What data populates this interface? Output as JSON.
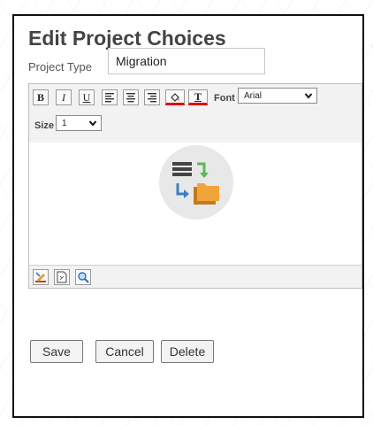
{
  "dialog": {
    "title": "Edit Project Choices",
    "project_type_label": "Project Type",
    "project_type_value": "Migration"
  },
  "toolbar": {
    "bold": "B",
    "italic": "I",
    "underline": "U",
    "text_color": "T",
    "font_label": "Font",
    "font_value": "Arial",
    "size_label": "Size",
    "size_value": "1"
  },
  "icons": {
    "toolbar": [
      "bold-icon",
      "italic-icon",
      "underline-icon",
      "align-left-icon",
      "align-center-icon",
      "align-right-icon",
      "background-color-icon",
      "text-color-icon"
    ],
    "bottom": [
      "edit-mode-icon",
      "source-view-icon",
      "preview-icon"
    ],
    "content": "migration-icon"
  },
  "buttons": {
    "save": "Save",
    "cancel": "Cancel",
    "delete": "Delete"
  },
  "colors": {
    "title": "#444444",
    "red_indicator": "#e00000",
    "icon_circle": "#e8e8e8",
    "folder_orange": "#f2a33a",
    "arrow_green": "#5cb85c",
    "arrow_blue": "#3b7fc4"
  }
}
